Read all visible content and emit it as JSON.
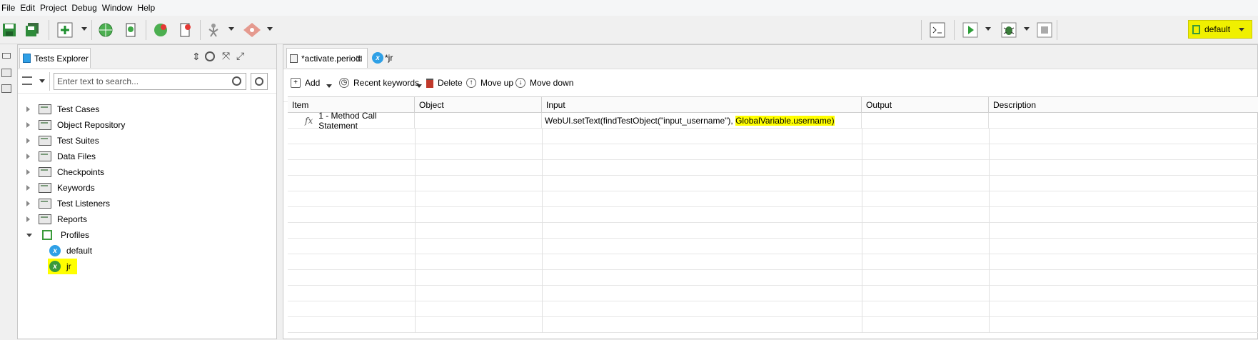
{
  "menu": [
    "File",
    "Edit",
    "Project",
    "Debug",
    "Window",
    "Help"
  ],
  "toolbar": {
    "profile_label": "default",
    "icons": [
      "save-icon",
      "save-all-icon",
      "add-icon",
      "spy-web-icon",
      "spy-mobile-icon",
      "record-web-icon",
      "record-mobile-icon",
      "keyword-icon",
      "git-icon",
      "terminal-icon",
      "run-icon",
      "debug-icon",
      "stop-icon"
    ]
  },
  "explorer": {
    "tab_label": "Tests Explorer",
    "search_placeholder": "Enter text to search...",
    "tree": [
      {
        "label": "Test Cases"
      },
      {
        "label": "Object Repository"
      },
      {
        "label": "Test Suites"
      },
      {
        "label": "Data Files"
      },
      {
        "label": "Checkpoints"
      },
      {
        "label": "Keywords"
      },
      {
        "label": "Test Listeners"
      },
      {
        "label": "Reports"
      },
      {
        "label": "Profiles"
      }
    ],
    "profiles": [
      {
        "label": "default"
      },
      {
        "label": "jr"
      }
    ]
  },
  "editor": {
    "tabs": [
      {
        "label": "*activate.period"
      },
      {
        "label": "*jr"
      }
    ],
    "actions": {
      "add": "Add",
      "recent": "Recent keywords",
      "delete": "Delete",
      "move_up": "Move up",
      "move_down": "Move down"
    },
    "columns": [
      "Item",
      "Object",
      "Input",
      "Output",
      "Description"
    ],
    "rows": [
      {
        "item": "1 - Method Call Statement",
        "object": "",
        "input_prefix": "WebUI.setText(findTestObject(\"input_username\"), ",
        "input_highlight": "GlobalVariable.username)",
        "output": "",
        "description": ""
      }
    ]
  }
}
